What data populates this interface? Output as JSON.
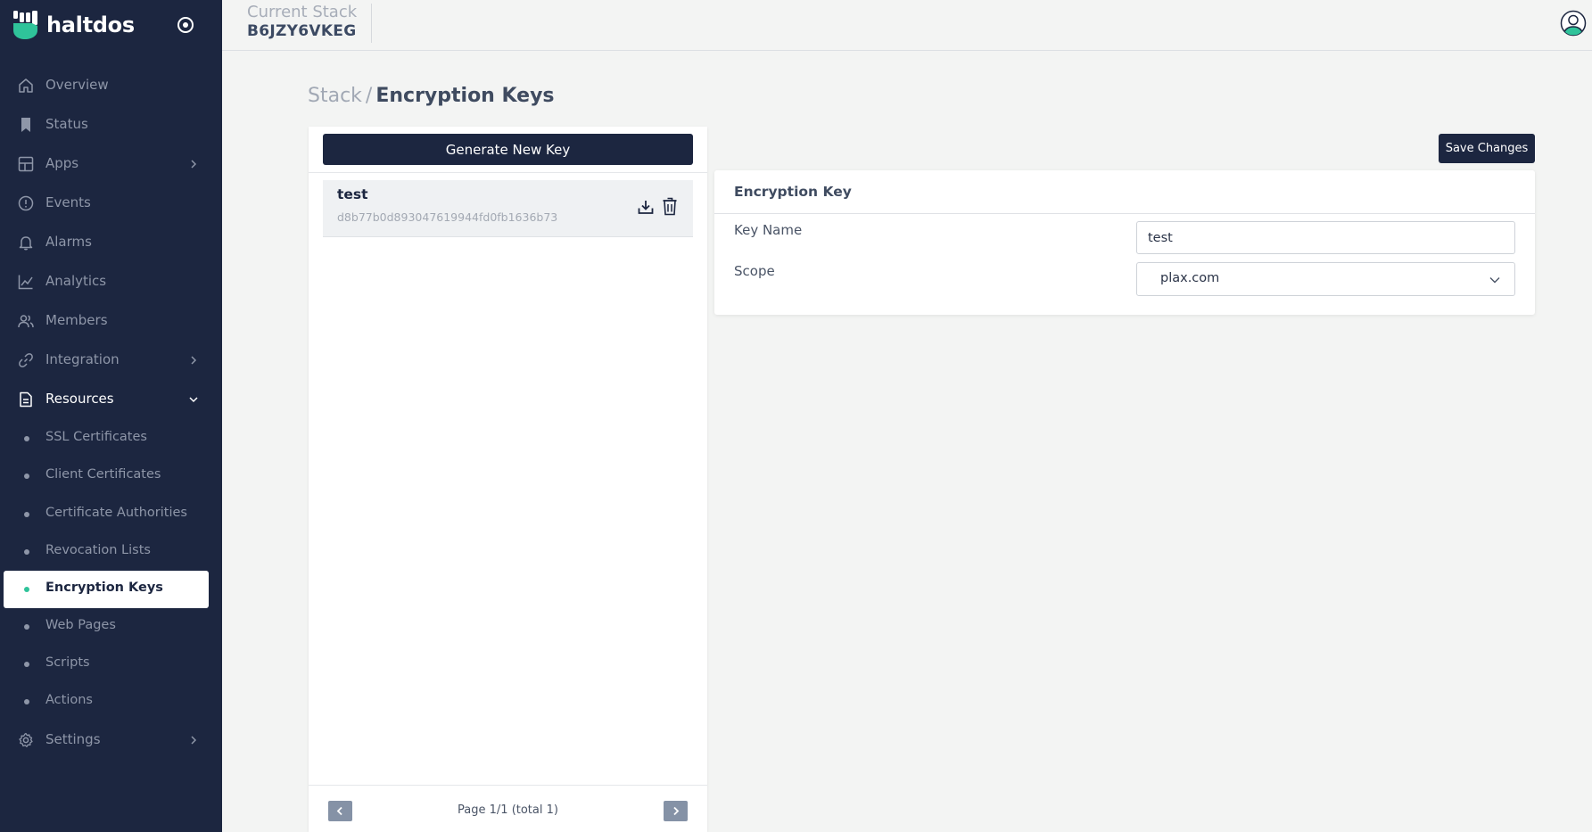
{
  "brand": {
    "name": "haltdos",
    "logo_icon": "haltdos-logo-icon",
    "accent": "#2fc39a",
    "sidebar_bg": "#1c2640"
  },
  "topbar": {
    "stack_label": "Current Stack",
    "stack_value": "B6JZY6VKEG",
    "profile_icon": "user-circle-icon"
  },
  "sidebar": {
    "items": [
      {
        "label": "Overview",
        "icon": "home-icon"
      },
      {
        "label": "Status",
        "icon": "bookmark-icon"
      },
      {
        "label": "Apps",
        "icon": "apps-grid-icon"
      },
      {
        "label": "Events",
        "icon": "alert-circle-icon"
      },
      {
        "label": "Alarms",
        "icon": "bell-icon"
      },
      {
        "label": "Analytics",
        "icon": "chart-line-icon"
      },
      {
        "label": "Members",
        "icon": "users-icon"
      },
      {
        "label": "Integration",
        "icon": "link-icon"
      },
      {
        "label": "Resources",
        "icon": "document-icon"
      }
    ],
    "sub_items": [
      {
        "label": "SSL Certificates"
      },
      {
        "label": "Client Certificates"
      },
      {
        "label": "Certificate Authorities"
      },
      {
        "label": "Revocation Lists"
      },
      {
        "label": "Encryption Keys"
      },
      {
        "label": "Web Pages"
      },
      {
        "label": "Scripts"
      },
      {
        "label": "Actions"
      }
    ],
    "settings": {
      "label": "Settings",
      "icon": "gear-icon"
    }
  },
  "breadcrumb": {
    "parent": "Stack",
    "separator": "/",
    "current": "Encryption Keys"
  },
  "keys_panel": {
    "generate_label": "Generate New Key",
    "keys": [
      {
        "name": "test",
        "hash": "d8b77b0d893047619944fd0fb1636b73"
      }
    ],
    "pagination": "Page 1/1 (total 1)"
  },
  "save_label": "Save Changes",
  "detail": {
    "title": "Encryption Key",
    "key_name_label": "Key Name",
    "key_name_value": "test",
    "scope_label": "Scope",
    "scope_value": "plax.com"
  }
}
